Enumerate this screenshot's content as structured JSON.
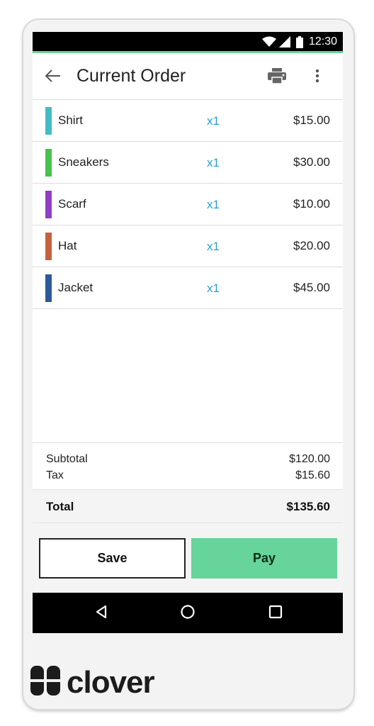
{
  "status_bar": {
    "time": "12:30"
  },
  "header": {
    "title": "Current Order"
  },
  "items": [
    {
      "name": "Shirt",
      "qty": "x1",
      "price": "$15.00",
      "color": "#43bcc4"
    },
    {
      "name": "Sneakers",
      "qty": "x1",
      "price": "$30.00",
      "color": "#48c24a"
    },
    {
      "name": "Scarf",
      "qty": "x1",
      "price": "$10.00",
      "color": "#8f3fc4"
    },
    {
      "name": "Hat",
      "qty": "x1",
      "price": "$20.00",
      "color": "#c5623f"
    },
    {
      "name": "Jacket",
      "qty": "x1",
      "price": "$45.00",
      "color": "#2c5a96"
    }
  ],
  "summary": {
    "subtotal_label": "Subtotal",
    "subtotal_value": "$120.00",
    "tax_label": "Tax",
    "tax_value": "$15.60",
    "total_label": "Total",
    "total_value": "$135.60"
  },
  "actions": {
    "save_label": "Save",
    "pay_label": "Pay"
  },
  "brand": {
    "name": "clover"
  },
  "colors": {
    "accent": "#66d49b",
    "qty": "#2a9fd6"
  }
}
